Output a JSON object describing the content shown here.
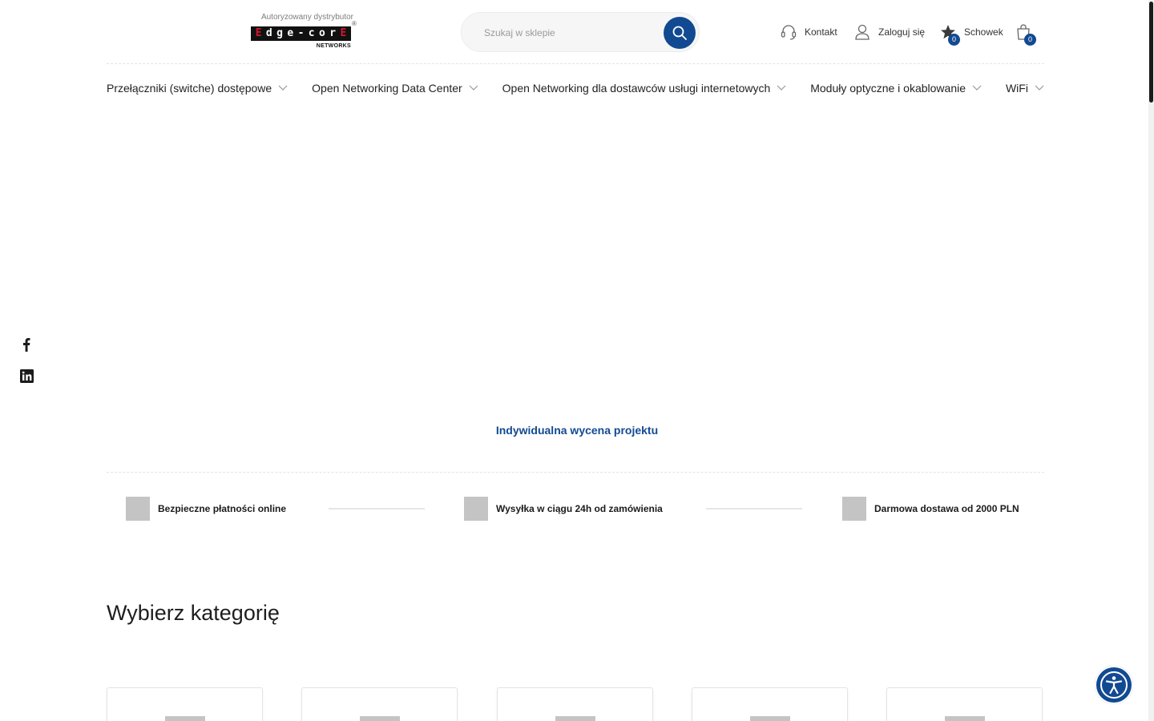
{
  "header": {
    "logo": {
      "tagline": "Autoryzowany dystrybutor",
      "letters": [
        "E",
        "d",
        "g",
        "e",
        "-",
        "c",
        "o",
        "r",
        "E"
      ],
      "reg": "®",
      "sub": "NETWORKS"
    },
    "search": {
      "placeholder": "Szukaj w sklepie",
      "value": ""
    },
    "links": {
      "contact": "Kontakt",
      "login": "Zaloguj się",
      "wishlist": "Schowek",
      "wishlist_count": "0",
      "cart_count": "0"
    }
  },
  "nav": {
    "items": [
      "Przełączniki (switche) dostępowe",
      "Open Networking Data Center",
      "Open Networking dla dostawców usługi internetowych",
      "Moduły optyczne i okablowanie",
      "WiFi"
    ]
  },
  "banner": {
    "cta": "Indywidualna wycena projektu"
  },
  "features": [
    "Bezpieczne płatności online",
    "Wysyłka w ciągu 24h od zamówienia",
    "Darmowa dostawa od 2000 PLN"
  ],
  "categories": {
    "title": "Wybierz kategorię"
  },
  "colors": {
    "accent": "#124a92",
    "logo_red": "#d5152d",
    "placeholder": "#c4c4c4"
  }
}
